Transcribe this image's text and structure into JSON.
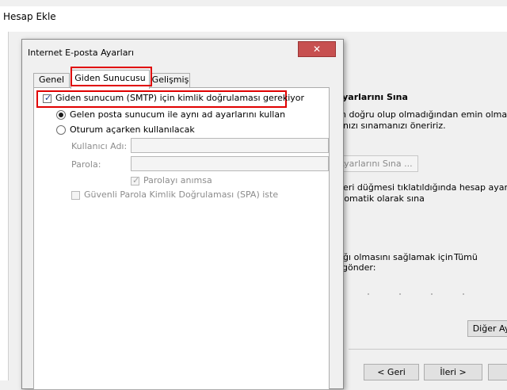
{
  "outer_window": {
    "title": "Hesap Ekle",
    "right_panel": {
      "heading": "Ayarlarını Sına",
      "line1": "n doğru olup olmadığından emin olmak",
      "line2": "ınızı sınamanızı öneririz.",
      "test_button": "Ayarlarını Sına ...",
      "line3": "leri düğmesi tıklatıldığında hesap ayarları",
      "line4": "tomatik olarak sına",
      "line5a": "ığı olmasını sağlamak için",
      "line5b": "Tümü",
      "line6": "gönder:",
      "more_button": "Diğer Ay"
    },
    "footer": {
      "back_button": "< Geri",
      "next_button": "İleri >"
    }
  },
  "dialog": {
    "title": "Internet E-posta Ayarları",
    "close_glyph": "✕",
    "tabs": [
      {
        "label": "Genel",
        "active": false
      },
      {
        "label": "Giden Sunucusu",
        "active": true
      },
      {
        "label": "Gelişmiş",
        "active": false
      }
    ],
    "smtp_auth": {
      "label": "Giden sunucum (SMTP) için kimlik doğrulaması gerekiyor",
      "checked": true
    },
    "radio_same": {
      "label": "Gelen posta sunucum ile aynı ad ayarlarını kullan",
      "selected": true
    },
    "radio_login": {
      "label": "Oturum açarken kullanılacak",
      "selected": false
    },
    "username_label": "Kullanıcı Adı:",
    "password_label": "Parola:",
    "remember_password": {
      "label": "Parolayı anımsa",
      "checked": true
    },
    "spa": {
      "label": "Güvenli Parola Kimlik Doğrulaması (SPA) iste",
      "checked": false
    }
  },
  "check_glyph": "✓"
}
